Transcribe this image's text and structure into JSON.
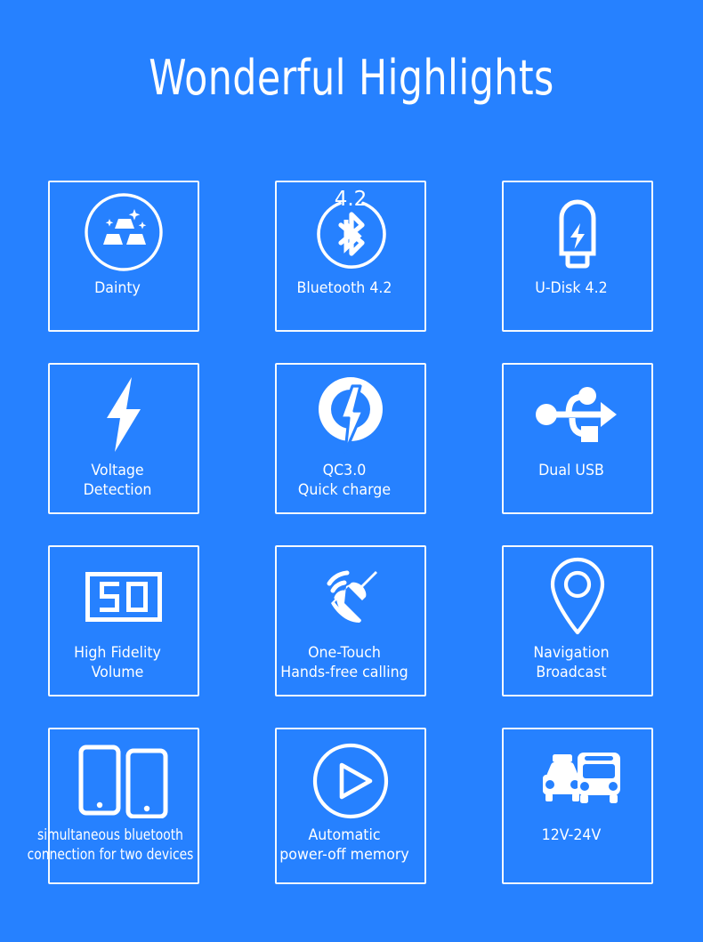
{
  "page": {
    "title": "Wonderful Highlights",
    "background_color": "#2681FF",
    "foreground_color": "#FFFFFF"
  },
  "cards": [
    {
      "id": "dainty",
      "icon": "gold-bars-circle-icon",
      "label": "Dainty"
    },
    {
      "id": "bluetooth",
      "icon": "bluetooth-icon",
      "label": "Bluetooth 4.2",
      "badge": "4.2"
    },
    {
      "id": "u-disk",
      "icon": "usb-flash-drive-icon",
      "label": "U-Disk 4.2"
    },
    {
      "id": "voltage-detection",
      "icon": "lightning-bolt-icon",
      "label": "Voltage\nDetection"
    },
    {
      "id": "qc30",
      "icon": "quick-charge-icon",
      "label": "QC3.0\nQuick charge"
    },
    {
      "id": "dual-usb",
      "icon": "usb-trident-icon",
      "label": "Dual USB"
    },
    {
      "id": "high-fidelity",
      "icon": "lcd-volume-50-icon",
      "label": "High Fidelity\nVolume",
      "display_value": "50"
    },
    {
      "id": "hands-free",
      "icon": "phone-handset-waves-icon",
      "label": "One-Touch\nHands-free calling"
    },
    {
      "id": "navigation",
      "icon": "map-pin-icon",
      "label": "Navigation\nBroadcast"
    },
    {
      "id": "two-devices",
      "icon": "two-phones-icon",
      "label": "simultaneous bluetooth\nconnection for two devices"
    },
    {
      "id": "power-off-memory",
      "icon": "play-circle-icon",
      "label": "Automatic\npower-off memory"
    },
    {
      "id": "voltage-range",
      "icon": "taxi-bus-icon",
      "label": "12V-24V"
    }
  ]
}
